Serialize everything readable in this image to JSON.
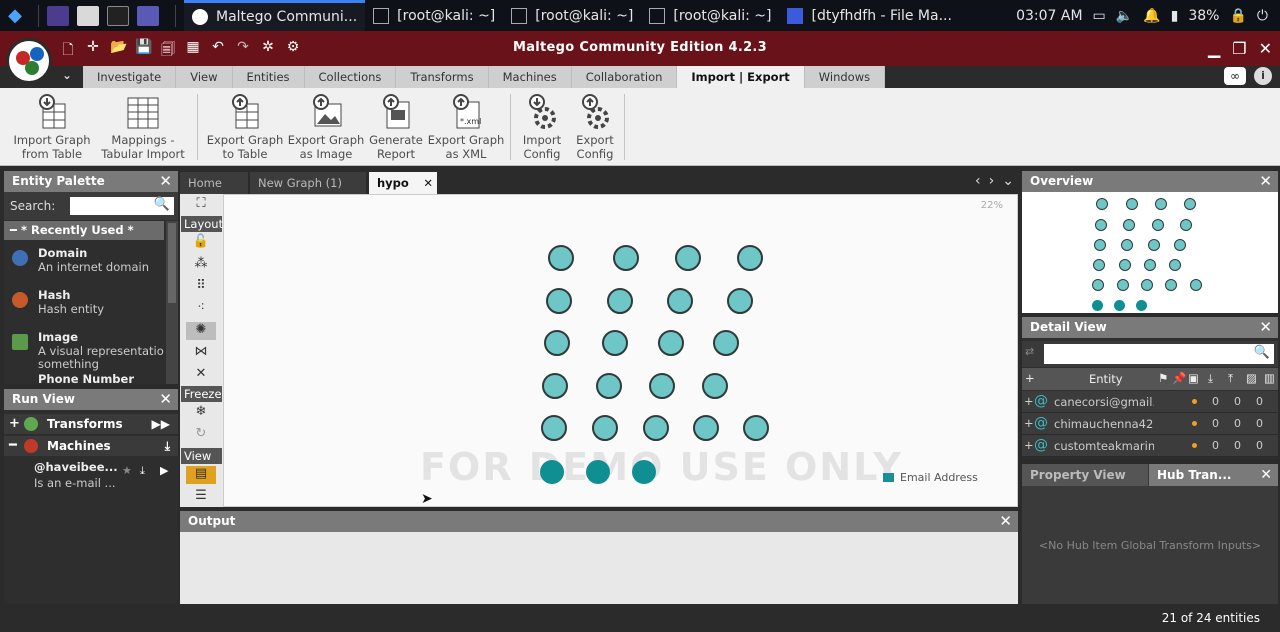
{
  "taskbar": {
    "tasks": [
      {
        "label": "Maltego Communi...",
        "active": true
      },
      {
        "label": "[root@kali: ~]",
        "active": false
      },
      {
        "label": "[root@kali: ~]",
        "active": false
      },
      {
        "label": "[root@kali: ~]",
        "active": false
      },
      {
        "label": "[dtyfhdfh - File Ma...",
        "active": false
      }
    ],
    "clock": "03:07 AM",
    "battery": "38%"
  },
  "app": {
    "title": "Maltego Community Edition 4.2.3",
    "menu_tabs": [
      "Investigate",
      "View",
      "Entities",
      "Collections",
      "Transforms",
      "Machines",
      "Collaboration",
      "Import | Export",
      "Windows"
    ],
    "active_menu": "Import | Export"
  },
  "ribbon": [
    {
      "line1": "Import Graph",
      "line2": "from Table"
    },
    {
      "line1": "Mappings -",
      "line2": "Tabular Import"
    },
    {
      "line1": "Export Graph",
      "line2": "to Table"
    },
    {
      "line1": "Export Graph",
      "line2": "as Image"
    },
    {
      "line1": "Generate",
      "line2": "Report"
    },
    {
      "line1": "Export Graph",
      "line2": "as XML"
    },
    {
      "line1": "Import",
      "line2": "Config"
    },
    {
      "line1": "Export",
      "line2": "Config"
    }
  ],
  "palette": {
    "title": "Entity Palette",
    "search_label": "Search:",
    "recent": "* Recently Used *",
    "entities": [
      {
        "name": "Domain",
        "desc": "An internet domain",
        "color": "#3f6fb5"
      },
      {
        "name": "Hash",
        "desc": "Hash entity",
        "color": "#c65a2b"
      },
      {
        "name": "Image",
        "desc": "A visual representatio",
        "desc2": "something",
        "color": "#5a9a4a"
      },
      {
        "name": "Phone Number",
        "desc": "",
        "color": "#888888"
      }
    ]
  },
  "runview": {
    "title": "Run View",
    "transforms": "Transforms",
    "machines": "Machines",
    "item_name": "@haveibee...",
    "item_desc": "Is an e-mail ..."
  },
  "graph": {
    "tabs": [
      "Home",
      "New Graph (1)",
      "hypo"
    ],
    "active_tab": "hypo",
    "zoom": "22%",
    "watermark": "FOR DEMO USE ONLY",
    "legend": "Email Address",
    "tool_labels": {
      "layout": "Layout",
      "freeze": "Freeze",
      "view": "View"
    }
  },
  "output": {
    "title": "Output"
  },
  "overview": {
    "title": "Overview"
  },
  "detail": {
    "title": "Detail View",
    "column": "Entity",
    "rows": [
      {
        "email": "canecorsi@gmail.",
        "a": "0",
        "b": "0",
        "c": "0"
      },
      {
        "email": "chimauchenna42@",
        "a": "0",
        "b": "0",
        "c": "0"
      },
      {
        "email": "customteakmarine",
        "a": "0",
        "b": "0",
        "c": "0"
      }
    ]
  },
  "property": {
    "tab1": "Property View",
    "tab2": "Hub Tran...",
    "empty": "<No Hub Item Global Transform Inputs>"
  },
  "status": {
    "count": "21 of 24 entities"
  }
}
